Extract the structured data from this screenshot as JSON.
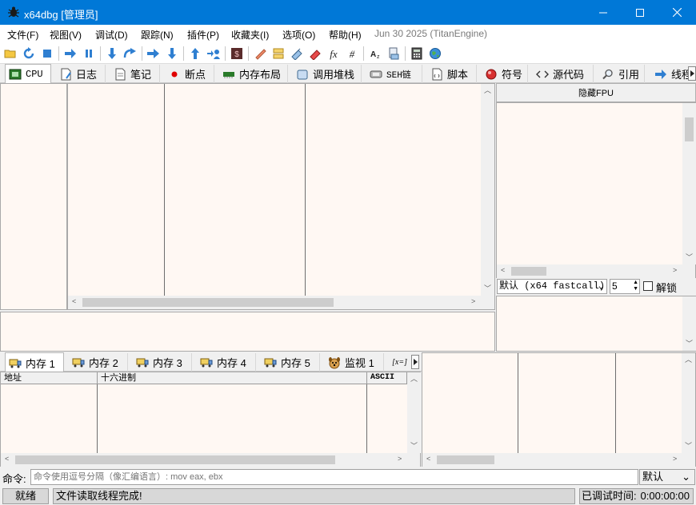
{
  "window": {
    "title": "x64dbg [管理员]"
  },
  "menu": {
    "items": [
      "文件(F)",
      "视图(V)",
      "调试(D)",
      "跟踪(N)",
      "插件(P)",
      "收藏夹(I)",
      "选项(O)",
      "帮助(H)"
    ],
    "info": "Jun 30 2025 (TitanEngine)"
  },
  "main_tabs": {
    "cpu": "CPU",
    "log": "日志",
    "notes": "笔记",
    "breakpoints": "断点",
    "memory_map": "内存布局",
    "call_stack": "调用堆栈",
    "seh": "SEH链",
    "script": "脚本",
    "symbols": "符号",
    "source": "源代码",
    "references": "引用",
    "threads": "线程"
  },
  "fpu": {
    "label": "隐藏FPU"
  },
  "callconv": {
    "selected": "默认 (x64 fastcall)",
    "arg_count": "5",
    "unlock_label": "解锁"
  },
  "dump_tabs": {
    "dump1": "内存 1",
    "dump2": "内存 2",
    "dump3": "内存 3",
    "dump4": "内存 4",
    "dump5": "内存 5",
    "watch1": "监视 1",
    "locals": "[x=]"
  },
  "dump_headers": {
    "address": "地址",
    "hex": "十六进制",
    "ascii": "ASCII"
  },
  "command": {
    "label": "命令:",
    "placeholder": "命令使用逗号分隔（像汇编语言）: mov eax, ebx",
    "mode": "默认"
  },
  "status": {
    "state": "就绪",
    "message": "文件读取线程完成!",
    "debug_time_label": "已调试时间:",
    "debug_time": "0:00:00:00"
  },
  "colors": {
    "titlebar": "#0078d7",
    "pane_bg": "#fff8f3",
    "breakpoint_dot": "#e00000"
  },
  "icons": {
    "toolbar": [
      "open-icon",
      "restart-icon",
      "stop-icon",
      "run-icon",
      "pause-icon",
      "step-into-icon",
      "step-over-icon",
      "trace-into-icon",
      "trace-over-icon",
      "execute-till-return-icon",
      "run-to-user-code-icon",
      "script-icon",
      "comment-icon",
      "label-icon",
      "bookmark-icon",
      "function-icon",
      "fx-icon",
      "hash-icon",
      "strings-icon",
      "patch-icon",
      "calculator-icon",
      "globe-icon"
    ]
  }
}
